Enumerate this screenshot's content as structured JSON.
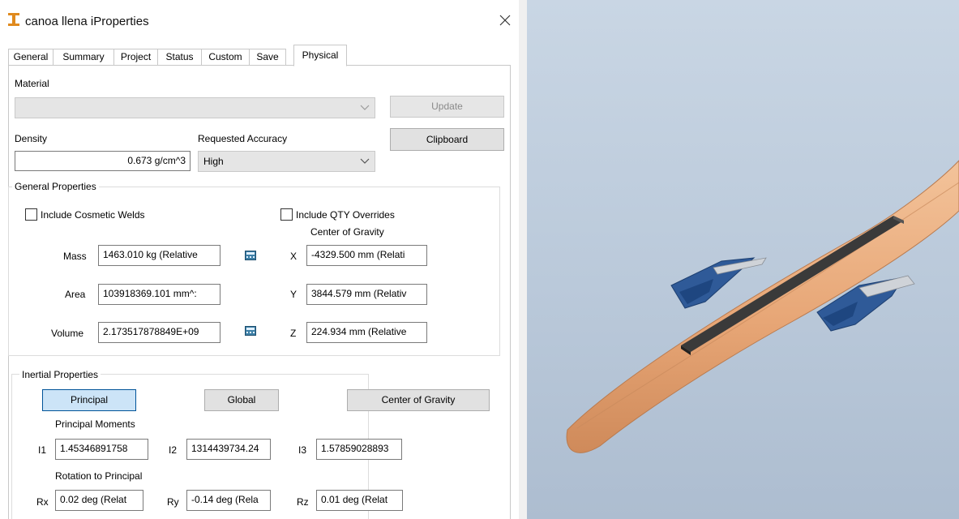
{
  "window": {
    "title": "canoa llena iProperties"
  },
  "tabs": [
    "General",
    "Summary",
    "Project",
    "Status",
    "Custom",
    "Save",
    "Physical"
  ],
  "active_tab": "Physical",
  "material": {
    "label": "Material",
    "value": ""
  },
  "buttons": {
    "update": "Update",
    "clipboard": "Clipboard"
  },
  "density": {
    "label": "Density",
    "value": "0.673 g/cm^3"
  },
  "accuracy": {
    "label": "Requested Accuracy",
    "value": "High"
  },
  "general_properties": {
    "title": "General Properties",
    "cosmetic_welds_label": "Include Cosmetic Welds",
    "qty_overrides_label": "Include QTY Overrides",
    "center_of_gravity_label": "Center of Gravity",
    "mass_label": "Mass",
    "mass_value": "1463.010 kg (Relative",
    "area_label": "Area",
    "area_value": "103918369.101 mm^:",
    "volume_label": "Volume",
    "volume_value": "2.173517878849E+09",
    "x_label": "X",
    "x_value": "-4329.500 mm (Relati",
    "y_label": "Y",
    "y_value": "3844.579 mm (Relativ",
    "z_label": "Z",
    "z_value": "224.934 mm (Relative"
  },
  "inertial_properties": {
    "title": "Inertial Properties",
    "principal_button": "Principal",
    "global_button": "Global",
    "cog_button": "Center of Gravity",
    "principal_moments_label": "Principal Moments",
    "i1_label": "I1",
    "i1_value": "1.45346891758",
    "i2_label": "I2",
    "i2_value": "1314439734.24",
    "i3_label": "I3",
    "i3_value": "1.57859028893",
    "rotation_label": "Rotation to Principal",
    "rx_label": "Rx",
    "rx_value": "0.02 deg (Relat",
    "ry_label": "Ry",
    "ry_value": "-0.14 deg (Rela",
    "rz_label": "Rz",
    "rz_value": "0.01 deg (Relat"
  },
  "colors": {
    "hull": "#e8aa78",
    "bar": "#3a3a3a",
    "outrigger": "#2f5a98",
    "viewport_bg": "#c2d0df"
  }
}
